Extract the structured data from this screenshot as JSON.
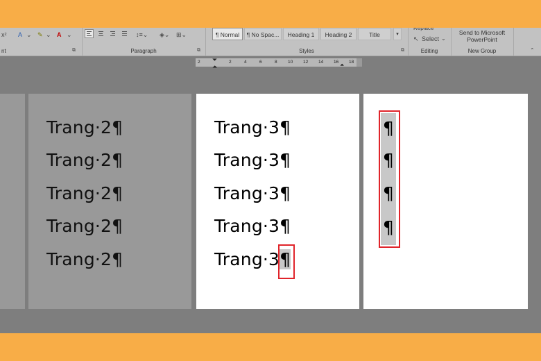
{
  "ribbon": {
    "font_group_label": "nt",
    "paragraph_group_label": "Paragraph",
    "styles_group_label": "Styles",
    "editing_group_label": "Editing",
    "newgroup_label": "New Group",
    "styles": [
      "¶ Normal",
      "¶ No Spac...",
      "Heading 1",
      "Heading 2",
      "Title"
    ],
    "replace_label": "Replace",
    "select_label": "Select",
    "send_label_1": "Send to Microsoft",
    "send_label_2": "PowerPoint"
  },
  "ruler": {
    "ticks": [
      "2",
      "2",
      "4",
      "6",
      "8",
      "10",
      "12",
      "14",
      "16",
      "18"
    ]
  },
  "pages": {
    "page2": {
      "lines": [
        "Trang·2¶",
        "Trang·2¶",
        "Trang·2¶",
        "Trang·2¶",
        "Trang·2¶"
      ]
    },
    "page3": {
      "lines": [
        "Trang·3¶",
        "Trang·3¶",
        "Trang·3¶",
        "Trang·3¶",
        "Trang·3"
      ],
      "last_mark": "¶"
    },
    "page4": {
      "marks": [
        "¶",
        "¶",
        "¶",
        "¶"
      ]
    }
  }
}
